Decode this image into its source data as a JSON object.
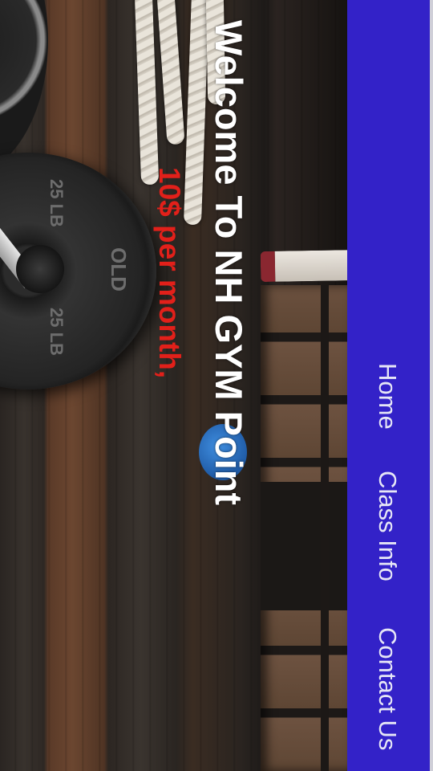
{
  "hero": {
    "title": "Welcome To NH GYM Point",
    "price": "10$ per month,"
  },
  "nav": {
    "items": [
      {
        "label": "Home"
      },
      {
        "label": "Class Info"
      },
      {
        "label": "Contact Us"
      }
    ]
  },
  "plate": {
    "marks": [
      "25 LB",
      "25 LB",
      "OLD"
    ]
  },
  "colors": {
    "nav_background": "#3322c8",
    "nav_text": "#e6e6f6",
    "title_text": "#ffffff",
    "price_text": "#e2201a"
  },
  "icons": {
    "background": "gym-photo-background"
  }
}
